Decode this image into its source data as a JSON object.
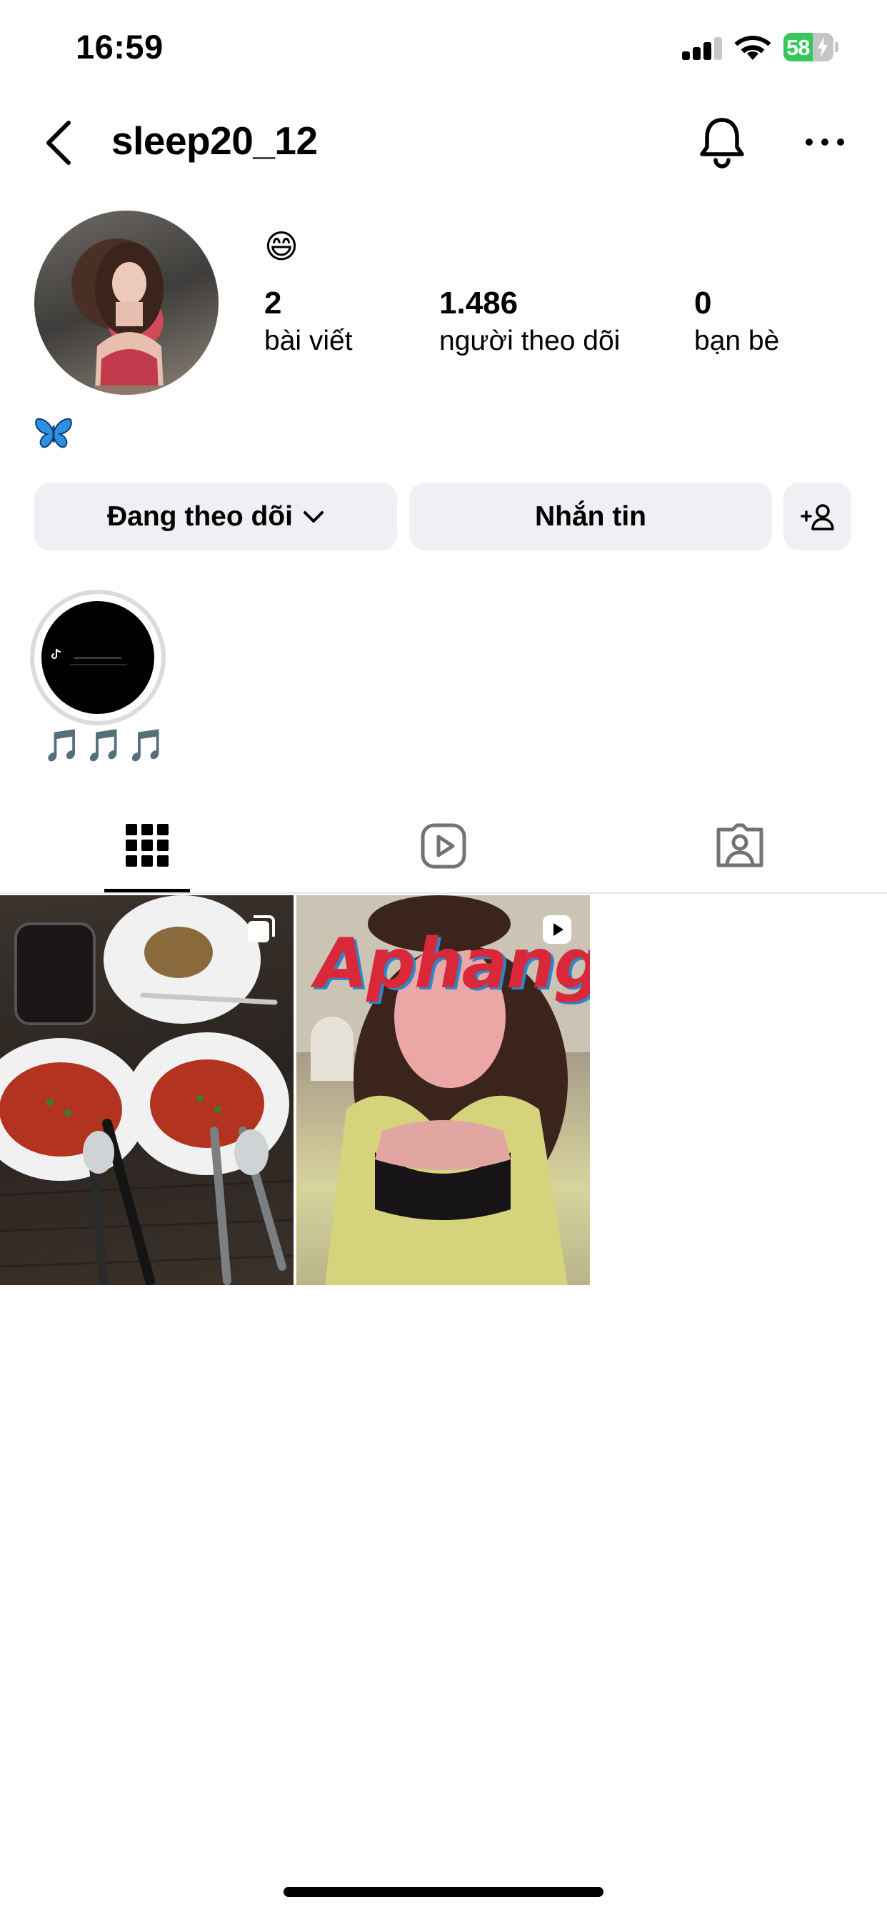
{
  "status_bar": {
    "time": "16:59",
    "battery_percent": "58",
    "battery_level": 0.58,
    "signal_bars_active": 3,
    "signal_bars_total": 4,
    "charging": true,
    "battery_color": "#34c759"
  },
  "header": {
    "username": "sleep20_12",
    "back_icon": "chevron-left-icon",
    "bell_icon": "bell-icon",
    "more_icon": "more-horizontal-icon"
  },
  "profile": {
    "bio_emoji": "😄",
    "bio_symbol_icon": "butterfly-icon",
    "stats": {
      "posts": {
        "value": "2",
        "label": "bài viết"
      },
      "followers": {
        "value": "1.486",
        "label": "người theo dõi"
      },
      "friends": {
        "value": "0",
        "label": "bạn bè"
      }
    }
  },
  "actions": {
    "following_label": "Đang theo dõi",
    "message_label": "Nhắn tin",
    "add_friend_icon": "add-person-icon"
  },
  "highlights": [
    {
      "label": "🎵🎵🎵"
    }
  ],
  "tabs": [
    {
      "icon": "grid-icon",
      "active": true
    },
    {
      "icon": "reels-icon",
      "active": false
    },
    {
      "icon": "tagged-icon",
      "active": false
    }
  ],
  "posts": [
    {
      "type": "carousel",
      "badge_icon": "carousel-icon"
    },
    {
      "type": "reel",
      "badge_icon": "reel-play-icon",
      "overlay_text": "Aphang"
    }
  ]
}
